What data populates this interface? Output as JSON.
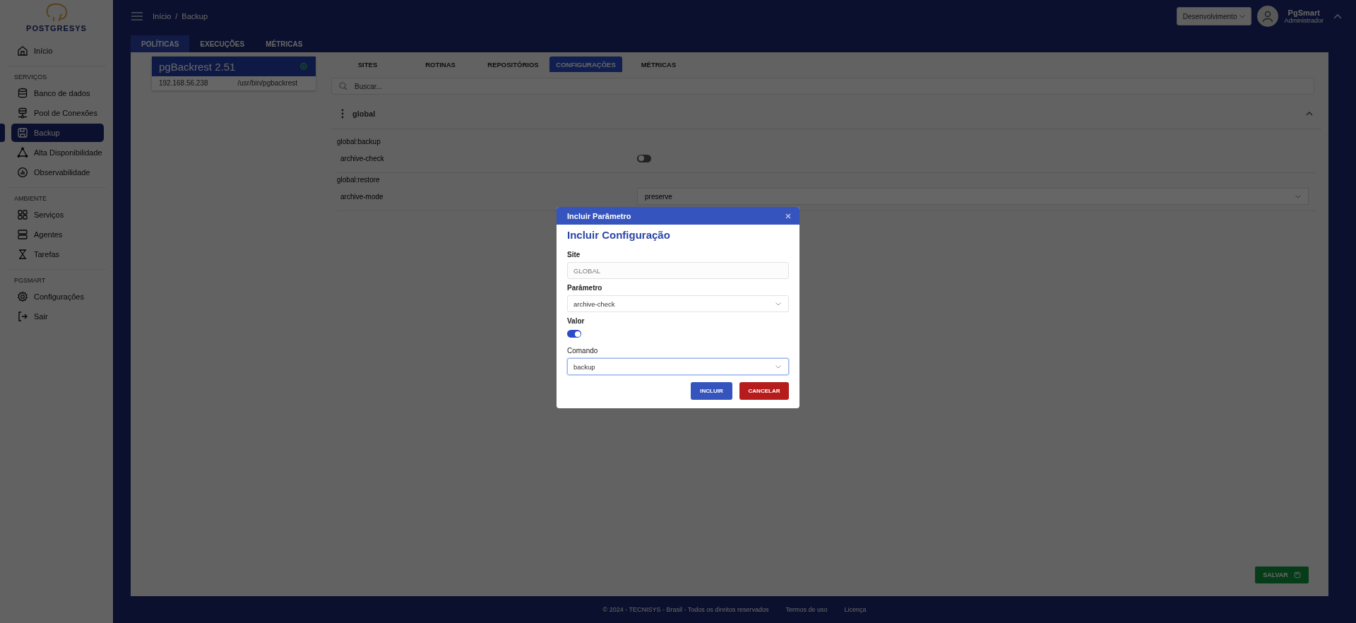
{
  "logo": {
    "text": "POSTGRESYS"
  },
  "sidebar": {
    "sections": [
      {
        "items": [
          {
            "label": "Início",
            "selected": false
          }
        ]
      },
      {
        "title": "SERVIÇOS",
        "items": [
          {
            "label": "Banco de dados",
            "selected": false
          },
          {
            "label": "Pool de Conexões",
            "selected": false
          },
          {
            "label": "Backup",
            "selected": true
          },
          {
            "label": "Alta Disponibilidade",
            "selected": false
          },
          {
            "label": "Observabilidade",
            "selected": false
          }
        ]
      },
      {
        "title": "AMBIENTE",
        "items": [
          {
            "label": "Serviços",
            "selected": false
          },
          {
            "label": "Agentes",
            "selected": false
          },
          {
            "label": "Tarefas",
            "selected": false
          }
        ]
      },
      {
        "title": "PGSMART",
        "items": [
          {
            "label": "Configurações",
            "selected": false
          },
          {
            "label": "Sair",
            "selected": false
          }
        ]
      }
    ]
  },
  "header": {
    "breadcrumb": [
      "Início",
      "Backup"
    ],
    "breadcrumb_separator": "/",
    "environment": "Desenvolvimento",
    "user_name": "PgSmart",
    "user_role": "Administrador"
  },
  "top_tabs": [
    {
      "label": "POLÍTICAS",
      "selected": true
    },
    {
      "label": "EXECUÇÕES",
      "selected": false
    },
    {
      "label": "MÉTRICAS",
      "selected": false
    }
  ],
  "server_card": {
    "title": "pgBackrest 2.51",
    "ip": "192.168.56.238",
    "path": "/usr/bin/pgbackrest"
  },
  "sub_tabs": [
    {
      "label": "SITES",
      "selected": false
    },
    {
      "label": "ROTINAS",
      "selected": false
    },
    {
      "label": "REPOSITÓRIOS",
      "selected": false
    },
    {
      "label": "CONFIGURAÇÕES",
      "selected": true
    },
    {
      "label": "MÉTRICAS",
      "selected": false
    }
  ],
  "search": {
    "placeholder": "Buscar..."
  },
  "section": {
    "title": "global",
    "expanded": true,
    "groups": [
      {
        "title": "global:backup",
        "params": [
          {
            "name": "archive-check",
            "kind": "toggle",
            "on": false
          }
        ]
      },
      {
        "title": "global:restore",
        "params": [
          {
            "name": "archive-mode",
            "kind": "select",
            "value": "preserve"
          }
        ]
      }
    ]
  },
  "save_button": "SALVAR",
  "footer": {
    "copyright": "© 2024 - TECNISYS - Brasil - Todos os direitos reservados",
    "links": [
      "Termos de uso",
      "Licença"
    ]
  },
  "modal": {
    "title": "Incluir Parâmetro",
    "heading": "Incluir Configuração",
    "fields": [
      {
        "label": "Site",
        "kind": "text",
        "value": "GLOBAL",
        "disabled": true,
        "focused": false
      },
      {
        "label": "Parâmetro",
        "kind": "select",
        "value": "archive-check",
        "disabled": false,
        "focused": false
      },
      {
        "label": "Valor",
        "kind": "toggle",
        "on": true
      },
      {
        "label": "Comando",
        "kind": "select",
        "value": "backup",
        "disabled": false,
        "focused": true
      }
    ],
    "buttons": [
      {
        "label": "INCLUIR",
        "kind": "primary"
      },
      {
        "label": "CANCELAR",
        "kind": "danger"
      }
    ]
  }
}
